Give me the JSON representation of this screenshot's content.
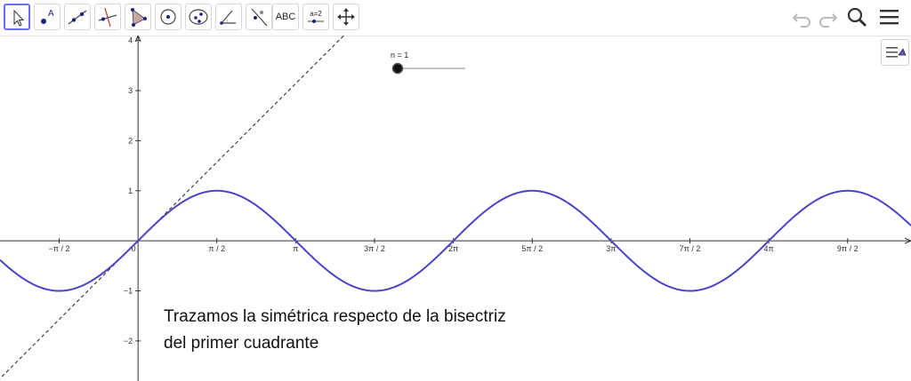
{
  "toolbar": {
    "tools": [
      "move",
      "point",
      "line",
      "perpendicular",
      "polygon",
      "circle",
      "conic",
      "angle",
      "reflect",
      "text",
      "slider",
      "move-view"
    ],
    "text_tool_label": "ABC",
    "slider_tool_label": "a=2"
  },
  "slider": {
    "label": "n = 1",
    "value": 1
  },
  "caption": {
    "line1": "Trazamos la simétrica respecto de la bisectriz",
    "line2": "del primer cuadrante"
  },
  "chart_data": {
    "type": "line",
    "series": [
      {
        "function": "sin(x)",
        "color": "#4a44c6",
        "style": "solid"
      },
      {
        "function": "x",
        "color": "#333333",
        "style": "dashed"
      }
    ],
    "x_tick_labels": [
      "−π / 2",
      "0",
      "π / 2",
      "π",
      "3π / 2",
      "2π",
      "5π / 2",
      "3π",
      "7π / 2",
      "4π",
      "9π / 2"
    ],
    "x_tick_values": [
      -1.5708,
      0,
      1.5708,
      3.1416,
      4.7124,
      6.2832,
      7.854,
      9.4248,
      10.9956,
      12.5664,
      14.1372
    ],
    "y_tick_labels": [
      "−2",
      "−1",
      "1",
      "2",
      "3",
      "4"
    ],
    "y_tick_values": [
      -2,
      -1,
      1,
      2,
      3,
      4
    ],
    "xlim": [
      -2.75,
      15.4
    ],
    "ylim": [
      -2.8,
      4.1
    ],
    "grid": false
  }
}
